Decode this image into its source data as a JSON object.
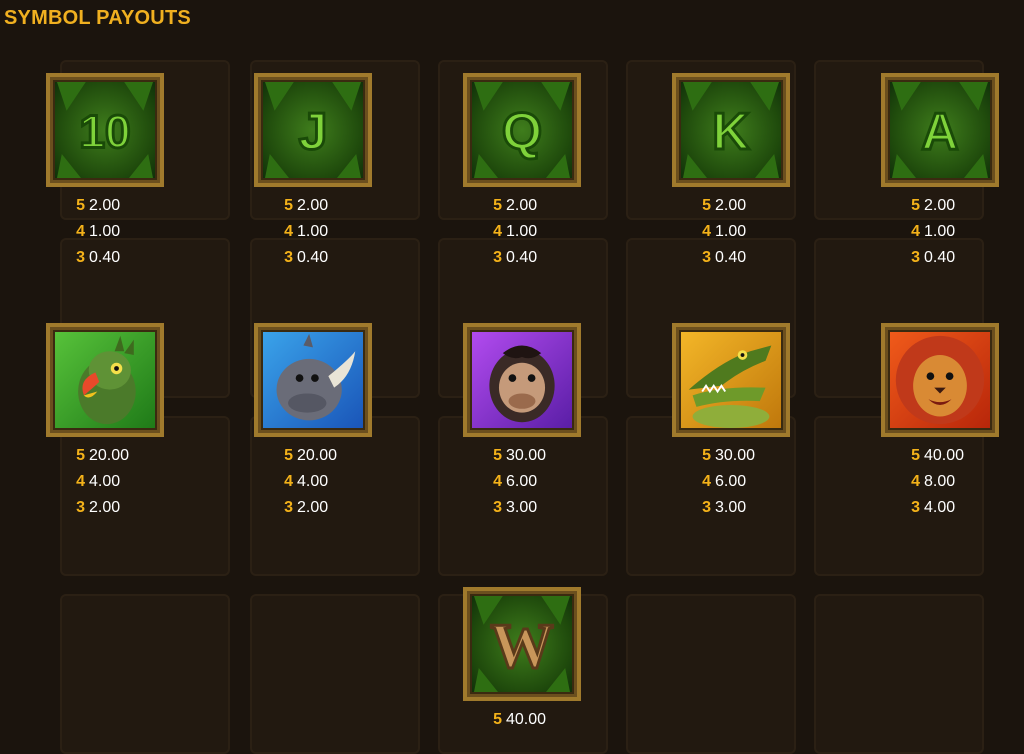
{
  "title": "SYMBOL PAYOUTS",
  "colors": {
    "title": "#f0b020",
    "count": "#f4b21a",
    "value": "#ffffff",
    "frame": "#a07a2c"
  },
  "symbols": [
    {
      "id": "10",
      "icon": "ten-symbol-icon",
      "glyph": "10",
      "pays": [
        {
          "count": "5",
          "value": "2.00"
        },
        {
          "count": "4",
          "value": "1.00"
        },
        {
          "count": "3",
          "value": "0.40"
        }
      ]
    },
    {
      "id": "J",
      "icon": "j-symbol-icon",
      "glyph": "J",
      "pays": [
        {
          "count": "5",
          "value": "2.00"
        },
        {
          "count": "4",
          "value": "1.00"
        },
        {
          "count": "3",
          "value": "0.40"
        }
      ]
    },
    {
      "id": "Q",
      "icon": "q-symbol-icon",
      "glyph": "Q",
      "pays": [
        {
          "count": "5",
          "value": "2.00"
        },
        {
          "count": "4",
          "value": "1.00"
        },
        {
          "count": "3",
          "value": "0.40"
        }
      ]
    },
    {
      "id": "K",
      "icon": "k-symbol-icon",
      "glyph": "K",
      "pays": [
        {
          "count": "5",
          "value": "2.00"
        },
        {
          "count": "4",
          "value": "1.00"
        },
        {
          "count": "3",
          "value": "0.40"
        }
      ]
    },
    {
      "id": "A",
      "icon": "a-symbol-icon",
      "glyph": "A",
      "pays": [
        {
          "count": "5",
          "value": "2.00"
        },
        {
          "count": "4",
          "value": "1.00"
        },
        {
          "count": "3",
          "value": "0.40"
        }
      ]
    },
    {
      "id": "parrot",
      "icon": "parrot-symbol-icon",
      "pays": [
        {
          "count": "5",
          "value": "20.00"
        },
        {
          "count": "4",
          "value": "4.00"
        },
        {
          "count": "3",
          "value": "2.00"
        }
      ]
    },
    {
      "id": "rhino",
      "icon": "rhino-symbol-icon",
      "pays": [
        {
          "count": "5",
          "value": "20.00"
        },
        {
          "count": "4",
          "value": "4.00"
        },
        {
          "count": "3",
          "value": "2.00"
        }
      ]
    },
    {
      "id": "gorilla",
      "icon": "gorilla-symbol-icon",
      "pays": [
        {
          "count": "5",
          "value": "30.00"
        },
        {
          "count": "4",
          "value": "6.00"
        },
        {
          "count": "3",
          "value": "3.00"
        }
      ]
    },
    {
      "id": "crocodile",
      "icon": "crocodile-symbol-icon",
      "pays": [
        {
          "count": "5",
          "value": "30.00"
        },
        {
          "count": "4",
          "value": "6.00"
        },
        {
          "count": "3",
          "value": "3.00"
        }
      ]
    },
    {
      "id": "lion",
      "icon": "lion-symbol-icon",
      "pays": [
        {
          "count": "5",
          "value": "40.00"
        },
        {
          "count": "4",
          "value": "8.00"
        },
        {
          "count": "3",
          "value": "4.00"
        }
      ]
    },
    {
      "id": "wild",
      "icon": "wild-symbol-icon",
      "glyph": "W",
      "pays": [
        {
          "count": "5",
          "value": "40.00"
        }
      ]
    }
  ]
}
